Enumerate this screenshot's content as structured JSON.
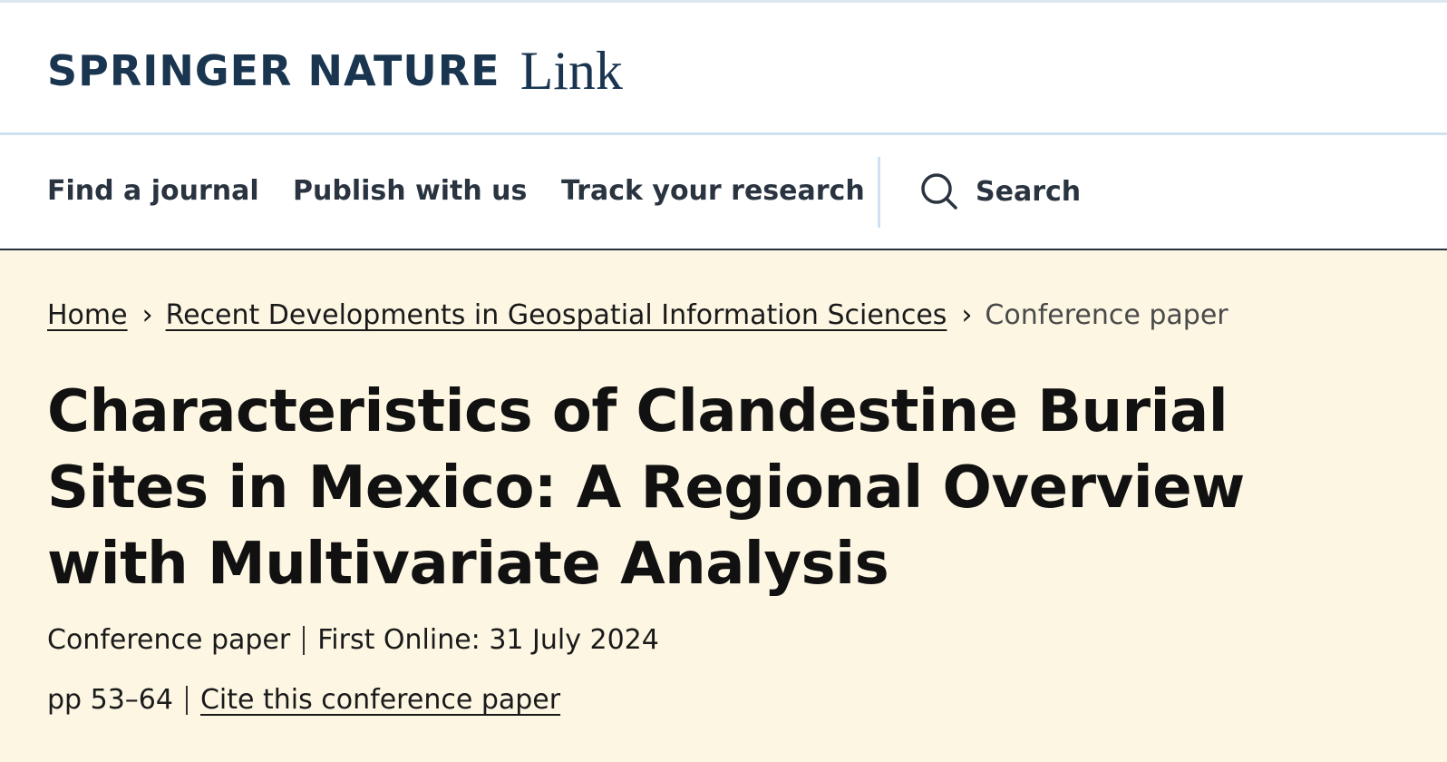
{
  "header": {
    "logo_springer": "SPRINGER NATURE",
    "logo_link": "Link"
  },
  "nav": {
    "items": [
      {
        "label": "Find a journal"
      },
      {
        "label": "Publish with us"
      },
      {
        "label": "Track your research"
      }
    ],
    "search_label": "Search",
    "search_icon": "search-icon"
  },
  "breadcrumb": {
    "home": "Home",
    "book": "Recent Developments in Geospatial Information Sciences",
    "current": "Conference paper",
    "separator": "›"
  },
  "article": {
    "title": "Characteristics of Clandestine Burial Sites in Mexico: A Regional Overview with Multivariate Analysis",
    "type": "Conference paper",
    "first_online": "First Online: 31 July 2024",
    "pages": "pp 53–64",
    "cite_label": "Cite this conference paper"
  },
  "colors": {
    "brand": "#1a3550",
    "hero_bg": "#fcf6e3",
    "nav_border": "#27343f",
    "divider": "#cfe0f0"
  }
}
